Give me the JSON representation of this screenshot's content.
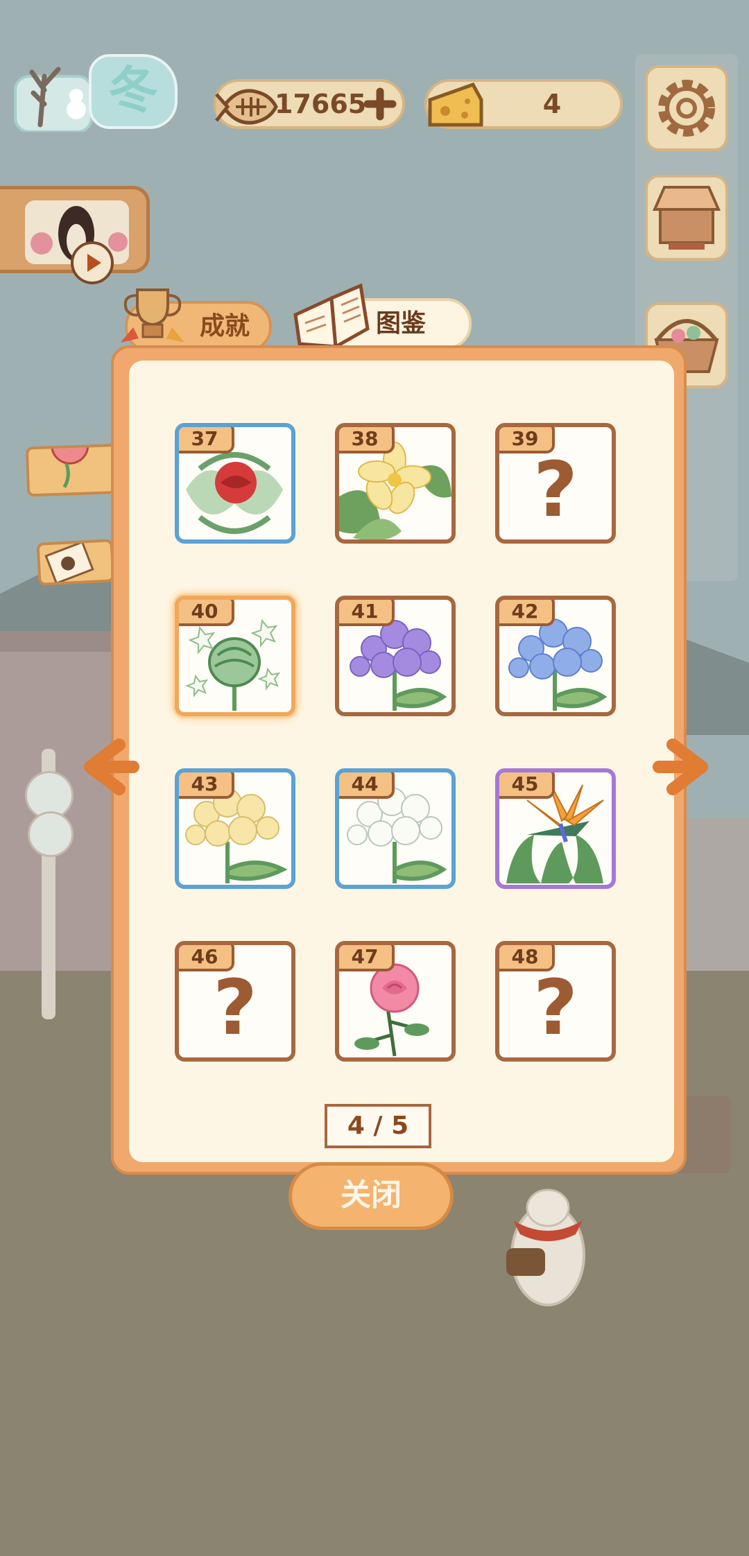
{
  "hud": {
    "season_label": "冬",
    "fish_count": "17665",
    "cheese_count": "4"
  },
  "tabs": {
    "achievement_label": "成就",
    "collection_label": "图鉴"
  },
  "collection": {
    "page_indicator": "4 / 5",
    "cards": [
      {
        "number": "37",
        "flower": "red-camellia",
        "rarity": "blue",
        "unlocked": true
      },
      {
        "number": "38",
        "flower": "yellow-frangipani",
        "rarity": "default",
        "unlocked": true
      },
      {
        "number": "39",
        "flower": "unknown",
        "rarity": "default",
        "unlocked": false,
        "mark": "?"
      },
      {
        "number": "40",
        "flower": "green-bud-white-stars",
        "rarity": "selected",
        "unlocked": true
      },
      {
        "number": "41",
        "flower": "purple-hydrangea",
        "rarity": "default",
        "unlocked": true
      },
      {
        "number": "42",
        "flower": "blue-hydrangea",
        "rarity": "default",
        "unlocked": true
      },
      {
        "number": "43",
        "flower": "yellow-cluster",
        "rarity": "blue",
        "unlocked": true
      },
      {
        "number": "44",
        "flower": "white-cluster",
        "rarity": "blue",
        "unlocked": true
      },
      {
        "number": "45",
        "flower": "bird-of-paradise",
        "rarity": "purple",
        "unlocked": true
      },
      {
        "number": "46",
        "flower": "unknown",
        "rarity": "default",
        "unlocked": false,
        "mark": "?"
      },
      {
        "number": "47",
        "flower": "pink-rose",
        "rarity": "default",
        "unlocked": true
      },
      {
        "number": "48",
        "flower": "unknown",
        "rarity": "default",
        "unlocked": false,
        "mark": "?"
      }
    ]
  },
  "buttons": {
    "close_label": "关闭"
  },
  "colors": {
    "panel": "#f0a86c",
    "panel_inner": "#fef6e4",
    "card_border": "#a8673f",
    "rare_blue": "#5ba2d6",
    "rare_purple": "#a578d8",
    "selected": "#f2a75b"
  }
}
